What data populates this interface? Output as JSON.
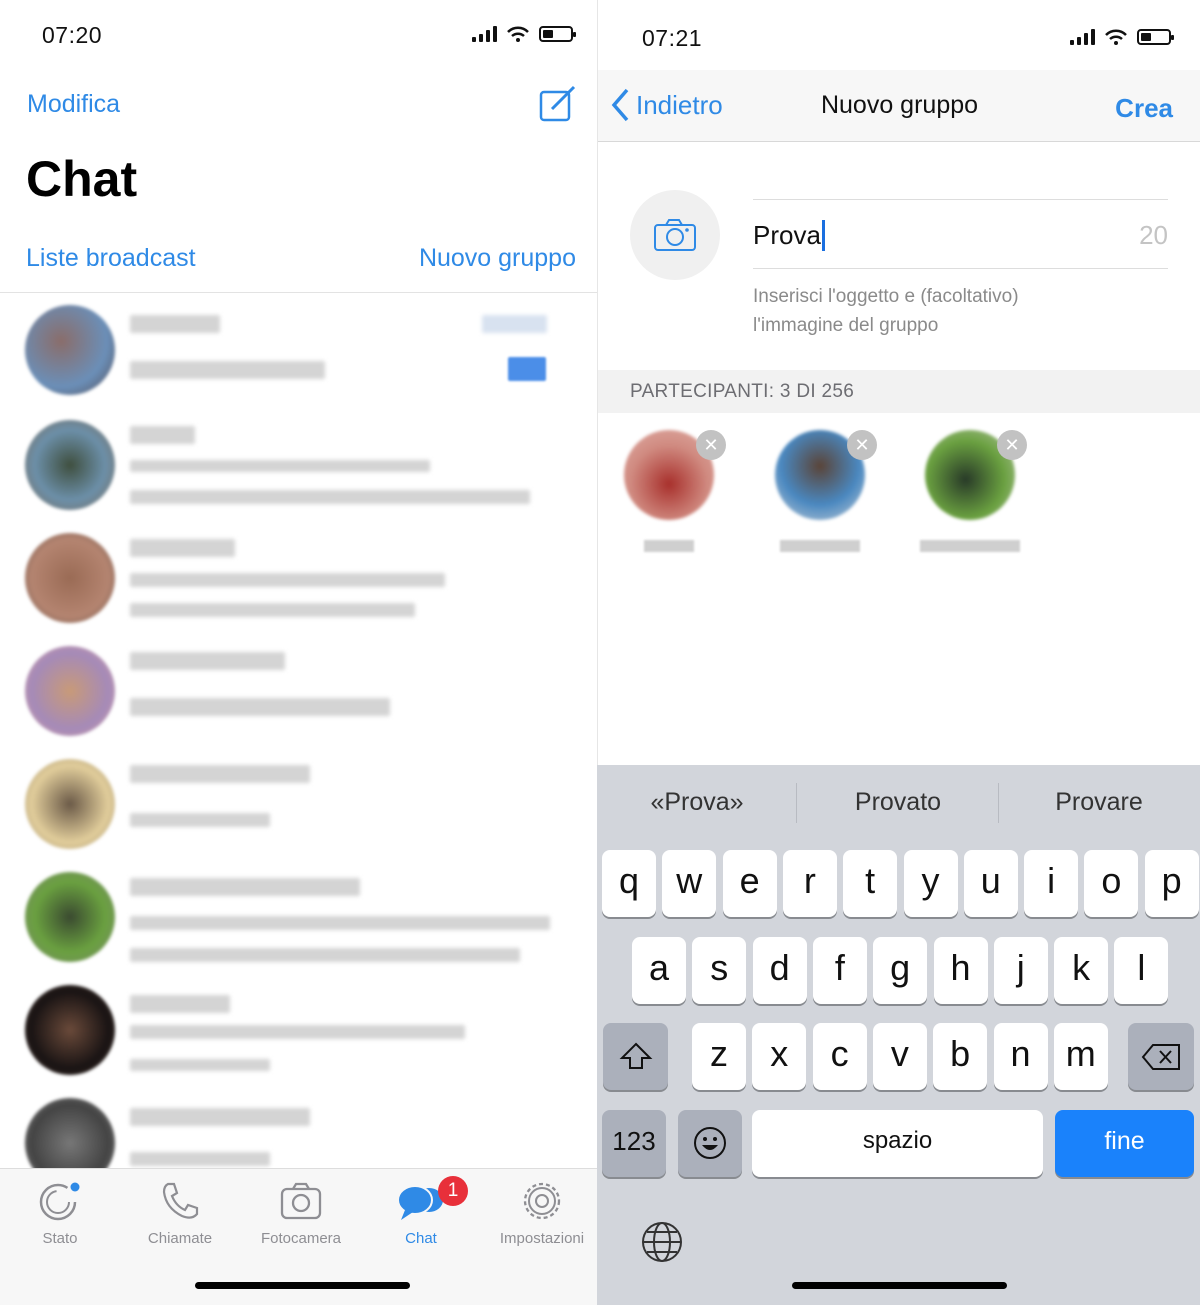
{
  "left": {
    "status": {
      "time": "07:20"
    },
    "nav": {
      "edit": "Modifica",
      "compose_icon": "compose-icon"
    },
    "title": "Chat",
    "links": {
      "broadcast": "Liste broadcast",
      "new_group": "Nuovo gruppo"
    },
    "tabs": [
      {
        "label": "Stato",
        "icon": "status-icon"
      },
      {
        "label": "Chiamate",
        "icon": "phone-icon"
      },
      {
        "label": "Fotocamera",
        "icon": "camera-icon"
      },
      {
        "label": "Chat",
        "icon": "chat-bubbles-icon",
        "active": true,
        "badge": "1"
      },
      {
        "label": "Impostazioni",
        "icon": "gear-icon"
      }
    ]
  },
  "right": {
    "status": {
      "time": "07:21"
    },
    "nav": {
      "back": "Indietro",
      "title": "Nuovo gruppo",
      "create": "Crea"
    },
    "subject": {
      "value": "Prova",
      "remaining": "20",
      "hint": "Inserisci l'oggetto e (facoltativo) l'immagine del gruppo"
    },
    "participants_header": "PARTECIPANTI: 3 DI 256",
    "keyboard": {
      "suggestions": [
        "«Prova»",
        "Provato",
        "Provare"
      ],
      "row1": [
        "q",
        "w",
        "e",
        "r",
        "t",
        "y",
        "u",
        "i",
        "o",
        "p"
      ],
      "row2": [
        "a",
        "s",
        "d",
        "f",
        "g",
        "h",
        "j",
        "k",
        "l"
      ],
      "row3": [
        "z",
        "x",
        "c",
        "v",
        "b",
        "n",
        "m"
      ],
      "numbers": "123",
      "space": "spazio",
      "done": "fine"
    }
  },
  "colors": {
    "accent": "#2f8ae6",
    "badge": "#e8303a",
    "done_key": "#1a82fb"
  }
}
